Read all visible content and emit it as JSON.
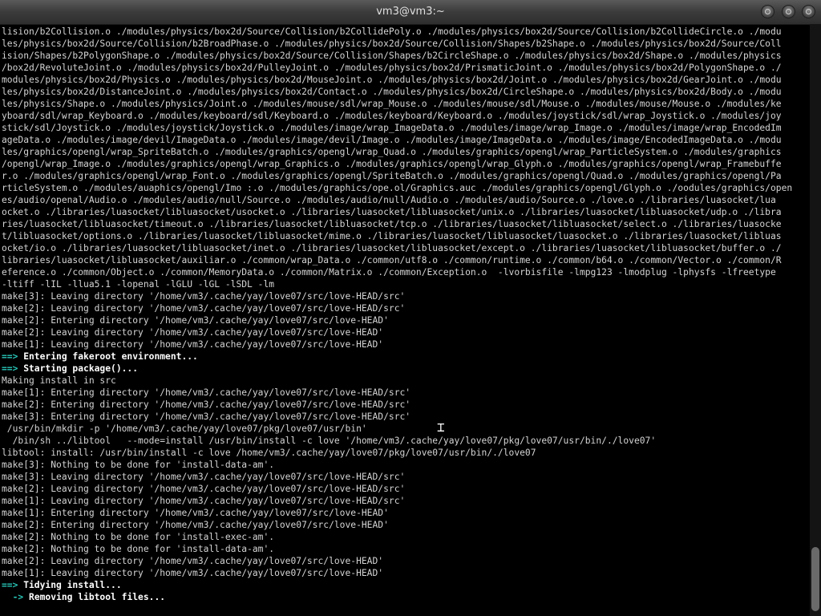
{
  "window": {
    "title": "vm3@vm3:~"
  },
  "icons": {
    "min": "minimize-icon",
    "max": "maximize-icon",
    "close": "close-icon",
    "cursor": "text-cursor-icon"
  },
  "colors": {
    "arrow": "#29c6b8",
    "text": "#d4d4d4",
    "bold": "#ffffff",
    "background": "#000000"
  },
  "lines": [
    {
      "text": "lision/b2Collision.o ./modules/physics/box2d/Source/Collision/b2CollidePoly.o ./modules/physics/box2d/Source/Collision/b2CollideCircle.o ./modu"
    },
    {
      "text": "les/physics/box2d/Source/Collision/b2BroadPhase.o ./modules/physics/box2d/Source/Collision/Shapes/b2Shape.o ./modules/physics/box2d/Source/Coll"
    },
    {
      "text": "ision/Shapes/b2PolygonShape.o ./modules/physics/box2d/Source/Collision/Shapes/b2CircleShape.o ./modules/physics/box2d/Shape.o ./modules/physics"
    },
    {
      "text": "/box2d/RevoluteJoint.o ./modules/physics/box2d/PulleyJoint.o ./modules/physics/box2d/PrismaticJoint.o ./modules/physics/box2d/PolygonShape.o ./"
    },
    {
      "text": "modules/physics/box2d/Physics.o ./modules/physics/box2d/MouseJoint.o ./modules/physics/box2d/Joint.o ./modules/physics/box2d/GearJoint.o ./modu"
    },
    {
      "text": "les/physics/box2d/DistanceJoint.o ./modules/physics/box2d/Contact.o ./modules/physics/box2d/CircleShape.o ./modules/physics/box2d/Body.o ./modu"
    },
    {
      "text": "les/physics/Shape.o ./modules/physics/Joint.o ./modules/mouse/sdl/wrap_Mouse.o ./modules/mouse/sdl/Mouse.o ./modules/mouse/Mouse.o ./modules/ke"
    },
    {
      "text": "yboard/sdl/wrap_Keyboard.o ./modules/keyboard/sdl/Keyboard.o ./modules/keyboard/Keyboard.o ./modules/joystick/sdl/wrap_Joystick.o ./modules/joy"
    },
    {
      "text": "stick/sdl/Joystick.o ./modules/joystick/Joystick.o ./modules/image/wrap_ImageData.o ./modules/image/wrap_Image.o ./modules/image/wrap_EncodedIm"
    },
    {
      "text": "ageData.o ./modules/image/devil/ImageData.o ./modules/image/devil/Image.o ./modules/image/ImageData.o ./modules/image/EncodedImageData.o ./modu"
    },
    {
      "text": "les/graphics/opengl/wrap_SpriteBatch.o ./modules/graphics/opengl/wrap_Quad.o ./modules/graphics/opengl/wrap_ParticleSystem.o ./modules/graphics"
    },
    {
      "text": "/opengl/wrap_Image.o ./modules/graphics/opengl/wrap_Graphics.o ./modules/graphics/opengl/wrap_Glyph.o ./modules/graphics/opengl/wrap_Framebuffe"
    },
    {
      "text": "r.o ./modules/graphics/opengl/wrap_Font.o ./modules/graphics/opengl/SpriteBatch.o ./modules/graphics/opengl/Quad.o ./modules/graphics/opengl/Pa"
    },
    {
      "text": "rticleSystem.o ./modules/auaphics/opengl/Imo :.o ./modules/graphics/ope.ol/Graphics.auc ./modules/graphics/opengl/Glyph.o ./oodules/graphics/open"
    },
    {
      "text": "es/audio/openal/Audio.o ./modules/audio/null/Source.o ./modules/audio/null/Audio.o ./modules/audio/Source.o ./love.o ./libraries/luasocket/lua"
    },
    {
      "text": "ocket.o ./libraries/luasocket/libluasocket/usocket.o ./libraries/luasocket/libluasocket/unix.o ./libraries/luasocket/libluasocket/udp.o ./libra"
    },
    {
      "text": "ries/luasocket/libluasocket/timeout.o ./libraries/luasocket/libluasocket/tcp.o ./libraries/luasocket/libluasocket/select.o ./libraries/luasocke"
    },
    {
      "text": "t/libluasocket/options.o ./libraries/luasocket/libluasocket/mime.o ./libraries/luasocket/libluasocket/luasocket.o ./libraries/luasocket/libluas"
    },
    {
      "text": "ocket/io.o ./libraries/luasocket/libluasocket/inet.o ./libraries/luasocket/libluasocket/except.o ./libraries/luasocket/libluasocket/buffer.o ./"
    },
    {
      "text": "libraries/luasocket/libluasocket/auxiliar.o ./common/wrap_Data.o ./common/utf8.o ./common/runtime.o ./common/b64.o ./common/Vector.o ./common/R"
    },
    {
      "text": "eference.o ./common/Object.o ./common/MemoryData.o ./common/Matrix.o ./common/Exception.o  -lvorbisfile -lmpg123 -lmodplug -lphysfs -lfreetype"
    },
    {
      "text": "-ltiff -lIL -llua5.1 -lopenal -lGLU -lGL -lSDL -lm"
    },
    {
      "text": "make[3]: Leaving directory '/home/vm3/.cache/yay/love07/src/love-HEAD/src'"
    },
    {
      "text": "make[2]: Leaving directory '/home/vm3/.cache/yay/love07/src/love-HEAD/src'"
    },
    {
      "text": "make[2]: Entering directory '/home/vm3/.cache/yay/love07/src/love-HEAD'"
    },
    {
      "text": "make[2]: Leaving directory '/home/vm3/.cache/yay/love07/src/love-HEAD'"
    },
    {
      "text": "make[1]: Leaving directory '/home/vm3/.cache/yay/love07/src/love-HEAD'"
    },
    {
      "arrow": "==>",
      "text": " Entering fakeroot environment..."
    },
    {
      "arrow": "==>",
      "text": " Starting package()..."
    },
    {
      "text": "Making install in src"
    },
    {
      "text": "make[1]: Entering directory '/home/vm3/.cache/yay/love07/src/love-HEAD/src'"
    },
    {
      "text": "make[2]: Entering directory '/home/vm3/.cache/yay/love07/src/love-HEAD/src'"
    },
    {
      "text": "make[3]: Entering directory '/home/vm3/.cache/yay/love07/src/love-HEAD/src'"
    },
    {
      "text": " /usr/bin/mkdir -p '/home/vm3/.cache/yay/love07/pkg/love07/usr/bin'"
    },
    {
      "text": "  /bin/sh ../libtool   --mode=install /usr/bin/install -c love '/home/vm3/.cache/yay/love07/pkg/love07/usr/bin/./love07'"
    },
    {
      "text": "libtool: install: /usr/bin/install -c love /home/vm3/.cache/yay/love07/pkg/love07/usr/bin/./love07"
    },
    {
      "text": "make[3]: Nothing to be done for 'install-data-am'."
    },
    {
      "text": "make[3]: Leaving directory '/home/vm3/.cache/yay/love07/src/love-HEAD/src'"
    },
    {
      "text": "make[2]: Leaving directory '/home/vm3/.cache/yay/love07/src/love-HEAD/src'"
    },
    {
      "text": "make[1]: Leaving directory '/home/vm3/.cache/yay/love07/src/love-HEAD/src'"
    },
    {
      "text": "make[1]: Entering directory '/home/vm3/.cache/yay/love07/src/love-HEAD'"
    },
    {
      "text": "make[2]: Entering directory '/home/vm3/.cache/yay/love07/src/love-HEAD'"
    },
    {
      "text": "make[2]: Nothing to be done for 'install-exec-am'."
    },
    {
      "text": "make[2]: Nothing to be done for 'install-data-am'."
    },
    {
      "text": "make[2]: Leaving directory '/home/vm3/.cache/yay/love07/src/love-HEAD'"
    },
    {
      "text": "make[1]: Leaving directory '/home/vm3/.cache/yay/love07/src/love-HEAD'"
    },
    {
      "arrow": "==>",
      "text": " Tidying install..."
    },
    {
      "arrow": "  ->",
      "text": " Removing libtool files..."
    }
  ]
}
